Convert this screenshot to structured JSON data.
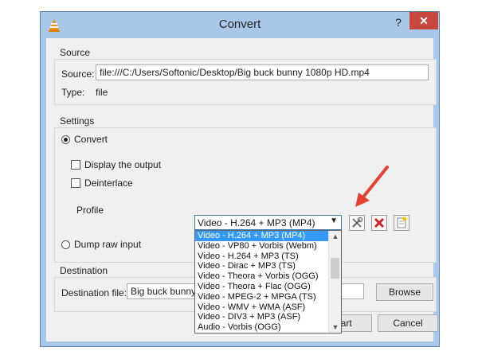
{
  "window": {
    "title": "Convert",
    "help_label": "?",
    "close_label": "✕"
  },
  "source": {
    "group_title": "Source",
    "source_label": "Source:",
    "source_value": "file:///C:/Users/Softonic/Desktop/Big buck bunny 1080p HD.mp4",
    "type_label": "Type:",
    "type_value": "file"
  },
  "settings": {
    "group_title": "Settings",
    "convert_label": "Convert",
    "display_output_label": "Display the output",
    "deinterlace_label": "Deinterlace",
    "profile_label": "Profile",
    "profile_selected": "Video - H.264 + MP3 (MP4)",
    "dump_raw_label": "Dump raw input",
    "profile_options": [
      "Video - H.264 + MP3 (MP4)",
      "Video - VP80 + Vorbis (Webm)",
      "Video - H.264 + MP3 (TS)",
      "Video - Dirac + MP3 (TS)",
      "Video - Theora + Vorbis (OGG)",
      "Video - Theora + Flac (OGG)",
      "Video - MPEG-2 + MPGA (TS)",
      "Video - WMV + WMA (ASF)",
      "Video - DIV3 + MP3 (ASF)",
      "Audio - Vorbis (OGG)"
    ]
  },
  "destination": {
    "group_title": "Destination",
    "file_label": "Destination file:",
    "file_value": "Big buck bunny Yo",
    "browse_label": "Browse"
  },
  "footer": {
    "start_label": "Start",
    "cancel_label": "Cancel"
  },
  "colors": {
    "frame": "#a9c7e6",
    "close": "#c8463c",
    "selection": "#3399ff",
    "arrow": "#e34234"
  }
}
